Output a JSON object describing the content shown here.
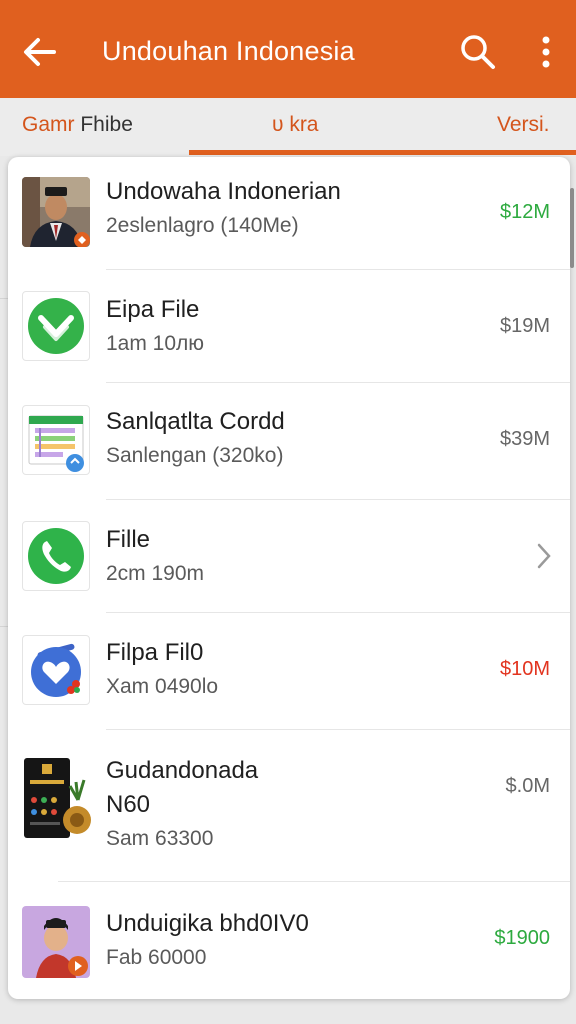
{
  "appbar": {
    "title": "Undouhan Indonesia",
    "back_icon": "arrow-left-icon",
    "search_icon": "search-icon",
    "more_icon": "more-vertical-icon",
    "color": "#e0601f"
  },
  "tabs": [
    {
      "label_part1": "Gamr",
      "label_part2": "Fhibe"
    },
    {
      "label": "υ kra"
    },
    {
      "label": "Versi."
    }
  ],
  "items": [
    {
      "name": "Undowaha Indonerian",
      "sub": "2eslenlagro (140Me)",
      "price": "$12M",
      "price_color": "#2daa3f",
      "icon": "person-photo-icon"
    },
    {
      "name": "Eipa File",
      "sub": "1am 10лю",
      "price": "$19M",
      "price_color": "#666666",
      "icon": "check-shield-icon"
    },
    {
      "name": "Sanlqatlta Cordd",
      "sub": "Sanlengan (320ko)",
      "price": "$39M",
      "price_color": "#666666",
      "icon": "spreadsheet-icon"
    },
    {
      "name": "Fille",
      "sub": "2cm 190m",
      "icon": "phone-icon",
      "trailing": "chevron-right-icon"
    },
    {
      "name": "Filpa Fil0",
      "sub": "Xam 0490lo",
      "price": "$10M",
      "price_color": "#e2341f",
      "icon": "heart-badge-icon"
    },
    {
      "name_line1": "Gudandonada",
      "name_line2": "N60",
      "sub": "Sam 63300",
      "price": "$.0M",
      "price_color": "#666666",
      "icon": "phone-plant-icon"
    },
    {
      "name": "Unduigika bhd0IV0",
      "sub": "Fab 60000",
      "price": "$1900",
      "price_color": "#2daa3f",
      "icon": "avatar-icon"
    }
  ]
}
